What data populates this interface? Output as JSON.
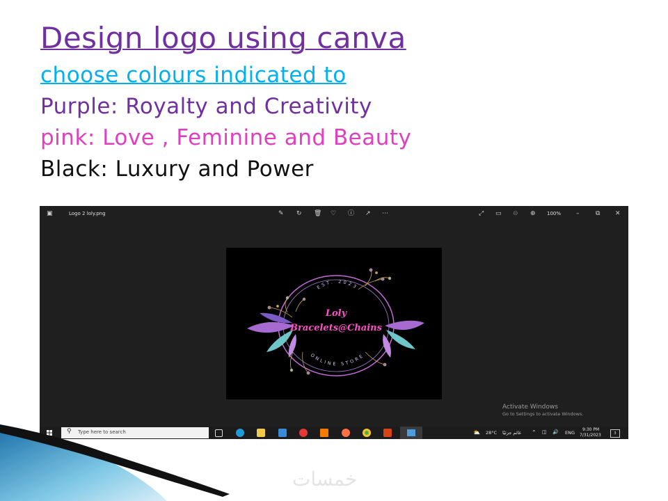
{
  "headings": {
    "line1": "Design logo using canva",
    "line2": "choose colours indicated to",
    "line3": "Purple: Royalty and Creativity",
    "line4": "pink: Love , Feminine and Beauty",
    "line5": "Black: Luxury and Power"
  },
  "colors": {
    "purple": "#7030a0",
    "cyan": "#00b0f0",
    "pink": "#e040c0",
    "black": "#111111"
  },
  "photo_viewer": {
    "file_name": "Logo 2 loly.png",
    "zoom": "100%",
    "toolbar_icons": [
      "edit-icon",
      "rotate-icon",
      "delete-icon",
      "favorite-icon",
      "info-icon",
      "share-icon",
      "more-icon"
    ],
    "right_icons": [
      "expand-icon",
      "slideshow-icon",
      "zoom-out-icon",
      "zoom-in-icon"
    ],
    "window_controls": [
      "minimize-icon",
      "maximize-icon",
      "close-icon"
    ]
  },
  "logo": {
    "top_text": "EST. 2023",
    "name": "Loly",
    "subtitle": "Bracelets@Chains",
    "bottom_text": "ONLINE STORE"
  },
  "activation": {
    "title": "Activate Windows",
    "subtitle": "Go to Settings to activate Windows."
  },
  "taskbar": {
    "search_placeholder": "Type here to search",
    "temperature": "28°C",
    "weather_text": "غائم جزئيًا",
    "language": "ENG",
    "time": "9:30 PM",
    "date": "7/31/2023",
    "notification_count": "3"
  },
  "watermark": "خمسات"
}
